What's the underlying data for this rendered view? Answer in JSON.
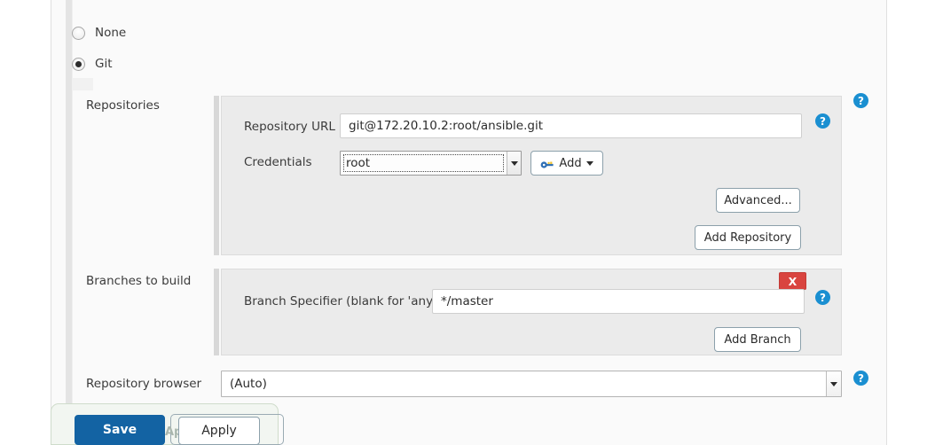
{
  "scm": {
    "options": [
      {
        "label": "None",
        "selected": false
      },
      {
        "label": "Git",
        "selected": true
      }
    ]
  },
  "repositories": {
    "section_label": "Repositories",
    "help_icon": "help-icon",
    "repository_url": {
      "label": "Repository URL",
      "value": "git@172.20.10.2:root/ansible.git",
      "help_icon": "help-icon"
    },
    "credentials": {
      "label": "Credentials",
      "value": "root",
      "add_button": {
        "label": "Add",
        "icon": "key-icon",
        "caret": "caret-down-icon"
      }
    },
    "advanced_button": "Advanced...",
    "add_repository_button": "Add Repository"
  },
  "branches": {
    "section_label": "Branches to build",
    "help_icon": "help-icon",
    "delete_button": "X",
    "branch_specifier": {
      "label": "Branch Specifier (blank for 'any')",
      "value": "*/master",
      "help_icon": "help-icon"
    },
    "add_branch_button": "Add Branch"
  },
  "repository_browser": {
    "label": "Repository browser",
    "value": "(Auto)",
    "help_icon": "help-icon"
  },
  "save_bar": {
    "save_label": "Save",
    "apply_label": "Apply",
    "occluded_apply_label": "Apply"
  },
  "colors": {
    "accent_blue": "#1363a3",
    "help_blue": "#1a8fd1",
    "delete_red": "#d9443f",
    "panel_gray": "#ebebeb",
    "canvas_gray": "#fafafa",
    "savebar_green": "#f2f6f1"
  }
}
